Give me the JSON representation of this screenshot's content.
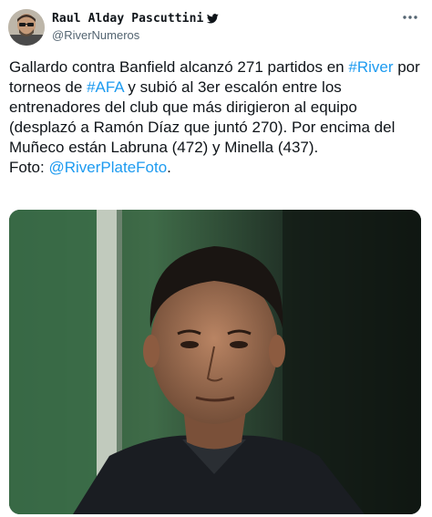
{
  "author": {
    "display_name": "Raul Alday Pascuttini",
    "handle": "@RiverNumeros",
    "avatar_icon": "avatar-photo",
    "verified_icon": "twitter-bird-icon"
  },
  "tweet": {
    "segments": [
      {
        "text": "Gallardo contra Banfield alcanzó 271 partidos en ",
        "type": "text"
      },
      {
        "text": "#River",
        "type": "link"
      },
      {
        "text": " por torneos de ",
        "type": "text"
      },
      {
        "text": "#AFA",
        "type": "link"
      },
      {
        "text": " y subió al 3er escalón entre los entrenadores del club que más dirigieron al equipo (desplazó a Ramón Díaz que juntó 270). Por encima del Muñeco están Labruna (472) y Minella (437).",
        "type": "text"
      },
      {
        "text": "Foto: ",
        "type": "text",
        "newline_before": true
      },
      {
        "text": "@RiverPlateFoto",
        "type": "link"
      },
      {
        "text": ".",
        "type": "text"
      }
    ]
  },
  "media": {
    "type": "photo"
  },
  "colors": {
    "link": "#1d9bf0",
    "text": "#0f1419",
    "secondary": "#536471"
  }
}
